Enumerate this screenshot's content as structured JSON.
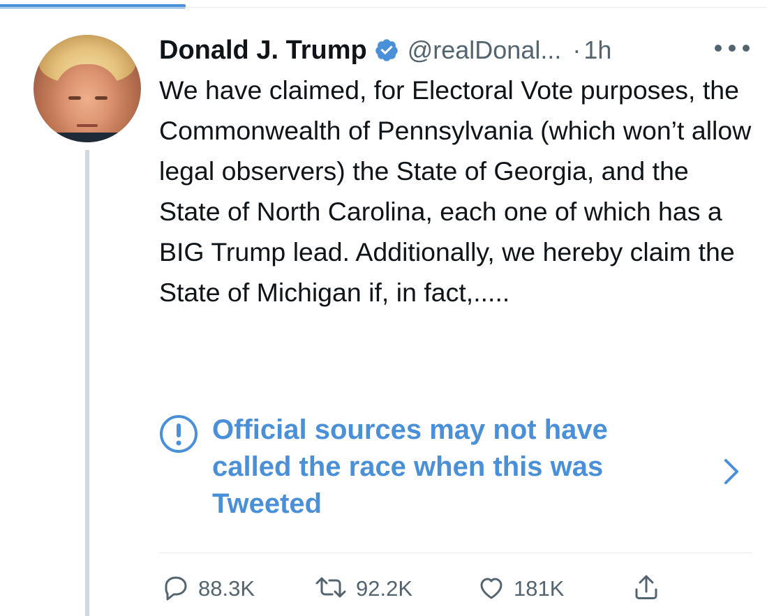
{
  "tweet": {
    "author": {
      "name": "Donald J. Trump",
      "handle": "@realDonal...",
      "verified": true
    },
    "time_separator": "·",
    "time": "1h",
    "text": "We have claimed, for Electoral Vote purposes, the Commonwealth of Pennsylvania (which won’t allow legal observers) the State of Georgia, and the State of North Carolina, each one of which has a BIG Trump lead. Additionally, we hereby claim the State of Michigan if, in fact,.....",
    "notice": "Official sources may not have called the race when this was Tweeted",
    "metrics": {
      "replies": "88.3K",
      "retweets": "92.2K",
      "likes": "181K"
    }
  },
  "icons": [
    "verified-badge-icon",
    "more-icon",
    "warning-icon",
    "chevron-right-icon",
    "reply-icon",
    "retweet-icon",
    "like-icon",
    "share-icon"
  ],
  "colors": {
    "accent": "#4a90d9",
    "text": "#0f1419",
    "secondary": "#536471",
    "divider": "#e6ecf0",
    "thread": "#cfd9de"
  }
}
